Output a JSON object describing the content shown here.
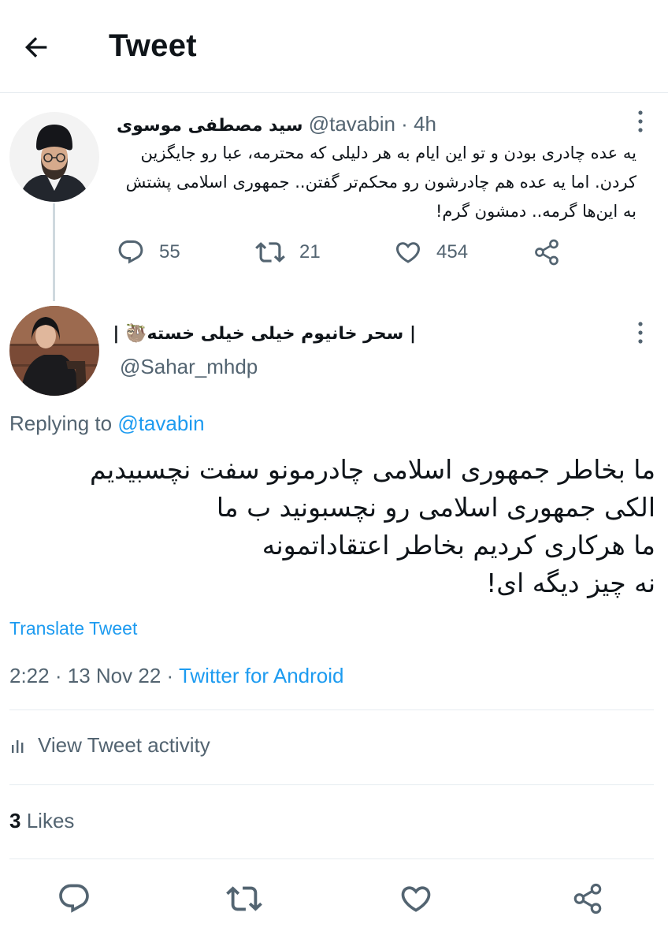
{
  "header": {
    "title": "Tweet"
  },
  "parent_tweet": {
    "author_name": "سید مصطفی موسوی",
    "handle": "@tavabin",
    "separator": "·",
    "time": "4h",
    "text": "یه عده چادری بودن و تو این ایام به هر دلیلی که محترمه، عبا رو جایگزین کردن. اما یه عده هم چادرشون رو محکم‌تر گفتن.. جمهوری اسلامی پشتش به این‌ها گرمه.. دمشون گرم!",
    "replies": "55",
    "retweets": "21",
    "likes": "454"
  },
  "main_tweet": {
    "author_name": "| سحر خانیوم خیلی خیلی خسته🦥 |",
    "handle": "@Sahar_mhdp",
    "replying_prefix": "Replying to",
    "replying_to": "@tavabin",
    "text": "ما بخاطر جمهوری اسلامی چادرمونو سفت نچسبیدیم\nالکی جمهوری اسلامی رو نچسبونید ب ما\nما هرکاری کردیم بخاطر اعتقاداتمونه\nنه چیز دیگه ای!",
    "translate_label": "Translate Tweet",
    "time": "2:22",
    "date": "13 Nov 22",
    "dot": "·",
    "source": "Twitter for Android",
    "activity_label": "View Tweet activity",
    "likes_count": "3",
    "likes_label": "Likes"
  },
  "colors": {
    "accent": "#1d9bf0",
    "secondary_text": "#536471",
    "primary_text": "#0f1419",
    "divider": "#e6ecf0"
  },
  "icons": [
    "back-arrow-icon",
    "more-vertical-icon",
    "reply-icon",
    "retweet-icon",
    "like-icon",
    "share-icon",
    "activity-bars-icon"
  ]
}
